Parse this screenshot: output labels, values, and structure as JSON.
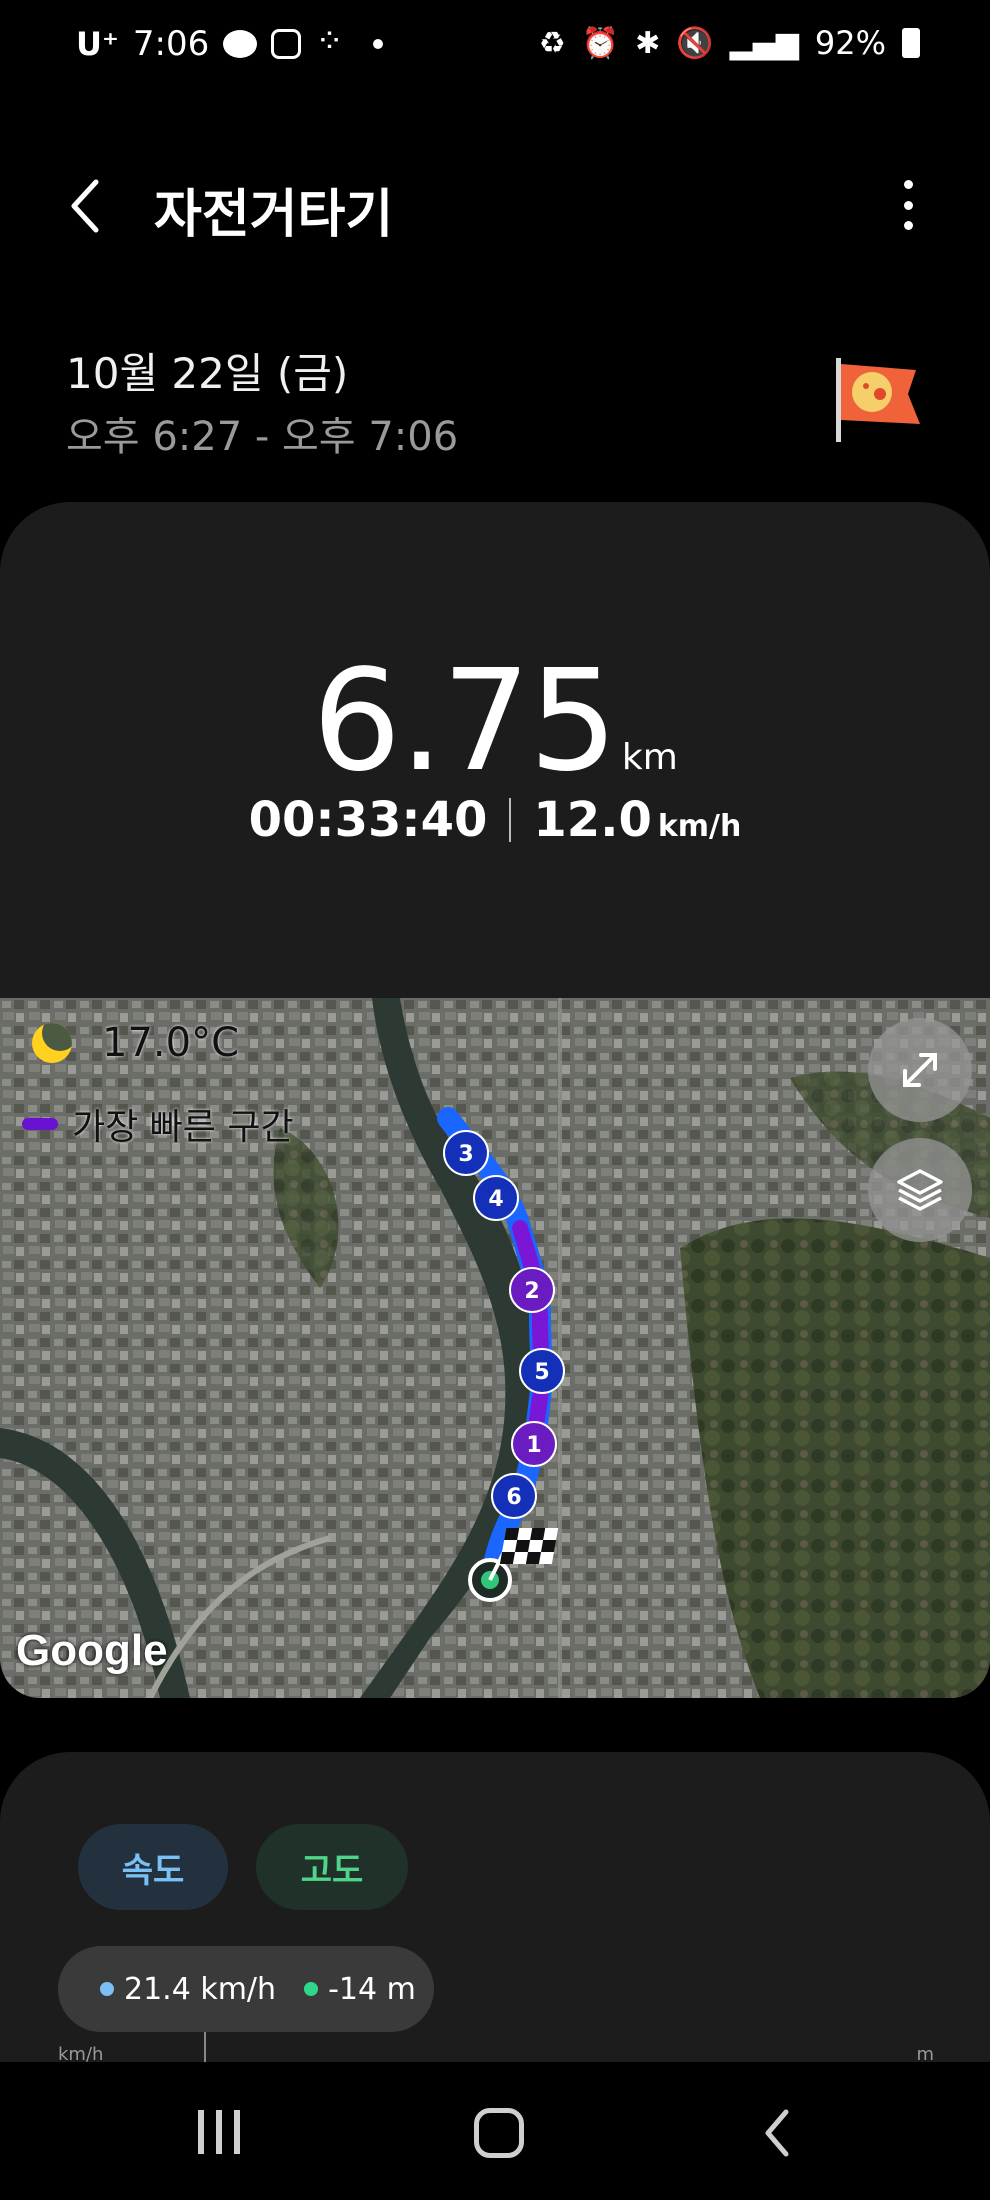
{
  "status_bar": {
    "carrier": "U⁺",
    "time": "7:06",
    "battery": "92%"
  },
  "header": {
    "title": "자전거타기"
  },
  "workout": {
    "date": "10월 22일 (금)",
    "time_range": "오후 6:27 - 오후 7:06",
    "distance_value": "6.75",
    "distance_unit": "km",
    "duration": "00:33:40",
    "avg_speed_value": "12.0",
    "avg_speed_unit": "km/h"
  },
  "map": {
    "temperature": "17.0°C",
    "legend_label": "가장 빠른 구간",
    "legend_color": "#6a12d2",
    "route_color": "#1a66ff",
    "fast_segment_color": "#7a16d6",
    "markers": [
      "3",
      "4",
      "2",
      "5",
      "1",
      "6"
    ],
    "attribution": "Google"
  },
  "chart_card": {
    "tab_speed": "속도",
    "tab_altitude": "고도",
    "readout_speed": "21.4 km/h",
    "readout_altitude": "-14 m",
    "speed_color": "#7ac0f5",
    "altitude_color": "#2fd78a",
    "axis_left": "km/h",
    "axis_right": "m"
  }
}
